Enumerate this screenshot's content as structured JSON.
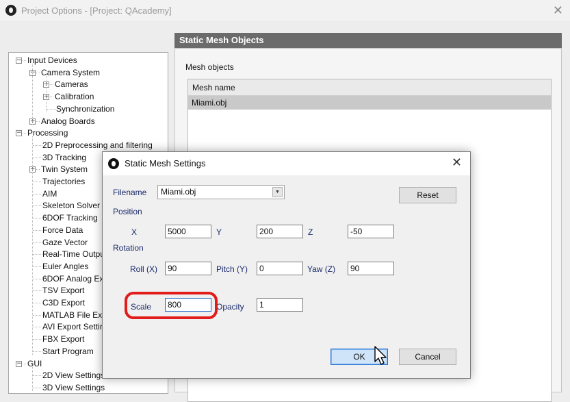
{
  "window": {
    "title": "Project Options - [Project: QAcademy]",
    "icon": "app-logo-icon",
    "close_symbol": "✕"
  },
  "tree": {
    "items": [
      {
        "label": "Input Devices",
        "expander": "−"
      },
      {
        "label": "Camera System",
        "expander": "−"
      },
      {
        "label": "Cameras",
        "expander": "+"
      },
      {
        "label": "Calibration",
        "expander": "+"
      },
      {
        "label": "Synchronization",
        "expander": ""
      },
      {
        "label": "Analog Boards",
        "expander": "+"
      },
      {
        "label": "Processing",
        "expander": "−"
      },
      {
        "label": "2D Preprocessing and filtering",
        "expander": ""
      },
      {
        "label": "3D Tracking",
        "expander": ""
      },
      {
        "label": "Twin System",
        "expander": "+"
      },
      {
        "label": "Trajectories",
        "expander": ""
      },
      {
        "label": "AIM",
        "expander": ""
      },
      {
        "label": "Skeleton Solver",
        "expander": ""
      },
      {
        "label": "6DOF Tracking",
        "expander": ""
      },
      {
        "label": "Force Data",
        "expander": ""
      },
      {
        "label": "Gaze Vector",
        "expander": ""
      },
      {
        "label": "Real-Time Outpu",
        "expander": ""
      },
      {
        "label": "Euler Angles",
        "expander": ""
      },
      {
        "label": "6DOF Analog Ex",
        "expander": ""
      },
      {
        "label": "TSV Export",
        "expander": ""
      },
      {
        "label": "C3D Export",
        "expander": ""
      },
      {
        "label": "MATLAB File Ex",
        "expander": ""
      },
      {
        "label": "AVI Export Settir",
        "expander": ""
      },
      {
        "label": "FBX Export",
        "expander": ""
      },
      {
        "label": "Start Program",
        "expander": ""
      },
      {
        "label": "GUI",
        "expander": "−"
      },
      {
        "label": "2D View Settings",
        "expander": ""
      },
      {
        "label": "3D View Settings",
        "expander": ""
      }
    ]
  },
  "panel": {
    "header": "Static Mesh Objects",
    "mesh_objects_label": "Mesh objects",
    "column_header": "Mesh name",
    "rows": [
      "Miami.obj"
    ]
  },
  "dialog": {
    "title": "Static Mesh Settings",
    "close_symbol": "✕",
    "filename_label": "Filename",
    "filename_value": "Miami.obj",
    "dropdown_arrow": "▼",
    "reset_label": "Reset",
    "position_label": "Position",
    "x_label": "X",
    "x_value": "5000",
    "y_label": "Y",
    "y_value": "200",
    "z_label": "Z",
    "z_value": "-50",
    "rotation_label": "Rotation",
    "roll_label": "Roll (X)",
    "roll_value": "90",
    "pitch_label": "Pitch (Y)",
    "pitch_value": "0",
    "yaw_label": "Yaw (Z)",
    "yaw_value": "90",
    "scale_label": "Scale",
    "scale_value": "800",
    "opacity_label": "Opacity",
    "opacity_value": "1",
    "ok_label": "OK",
    "cancel_label": "Cancel"
  },
  "annotation_color": "#e21b1b",
  "icons": [
    "app-logo-icon",
    "close-icon",
    "expander-icon",
    "dropdown-arrow-icon",
    "mouse-pointer-icon"
  ]
}
